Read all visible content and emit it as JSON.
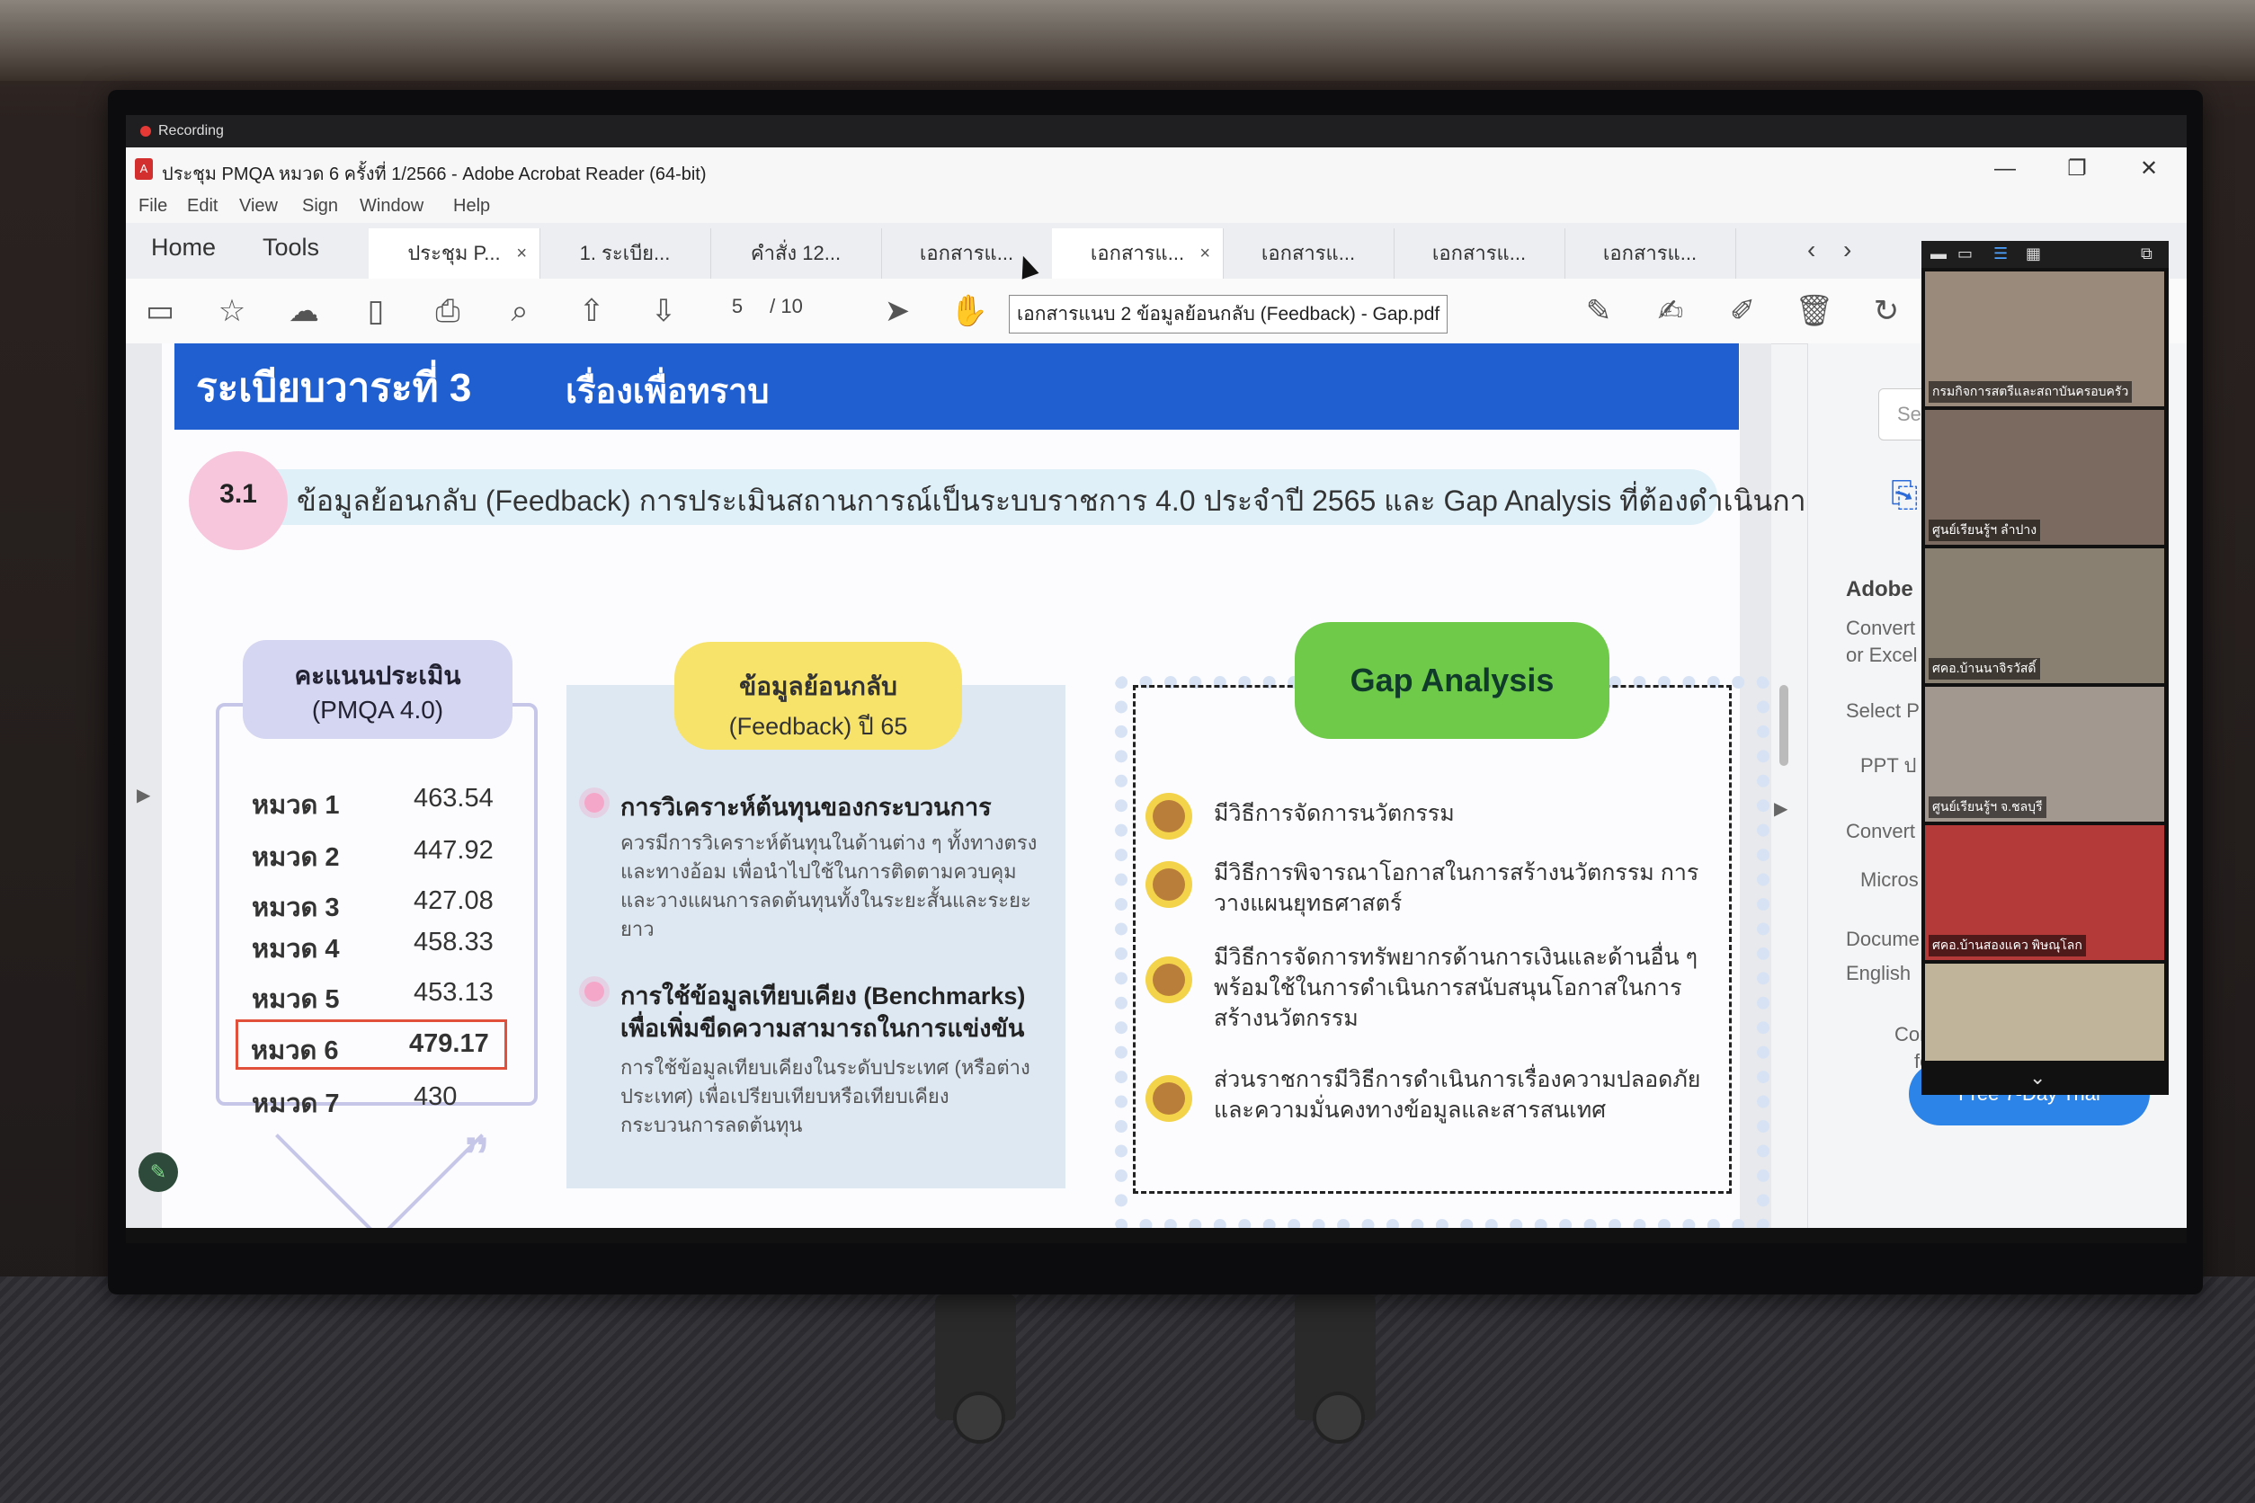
{
  "recording": {
    "label": "Recording"
  },
  "window": {
    "title": "ประชุม PMQA หมวด 6 ครั้งที่ 1/2566 - Adobe Acrobat Reader (64-bit)",
    "minimize": "—",
    "maximize": "❐",
    "close": "✕"
  },
  "menu": [
    "File",
    "Edit",
    "View",
    "Sign",
    "Window",
    "Help"
  ],
  "nav": {
    "home": "Home",
    "tools": "Tools"
  },
  "tabs": [
    "ประชุม P...",
    "1. ระเบีย...",
    "คำสั่ง 12...",
    "เอกสารแ...",
    "เอกสารแ...",
    "เอกสารแ...",
    "เอกสารแ...",
    "เอกสารแ..."
  ],
  "tab_close": "×",
  "tab_arrows": {
    "prev": "‹",
    "next": "›"
  },
  "toolbar": {
    "page_current": "5",
    "page_total": "/ 10"
  },
  "tooltip": "เอกสารแนบ 2 ข้อมูลย้อนกลับ (Feedback) - Gap.pdf",
  "doc": {
    "header_main": "ระเบียบวาระที่ 3",
    "header_sub": "เรื่องเพื่อทราบ",
    "section_no": "3.1",
    "section_text": "ข้อมูลย้อนกลับ (Feedback) การประเมินสถานการณ์เป็นระบบราชการ 4.0 ประจำปี 2565 และ Gap Analysis ที่ต้องดำเนินการฯ",
    "score": {
      "title1": "คะแนนประเมิน",
      "title2": "(PMQA 4.0)",
      "rows": [
        {
          "cat": "หมวด 1",
          "val": "463.54"
        },
        {
          "cat": "หมวด 2",
          "val": "447.92"
        },
        {
          "cat": "หมวด 3",
          "val": "427.08"
        },
        {
          "cat": "หมวด 4",
          "val": "458.33"
        },
        {
          "cat": "หมวด 5",
          "val": "453.13"
        },
        {
          "cat": "หมวด 6",
          "val": "479.17"
        },
        {
          "cat": "หมวด 7",
          "val": "430"
        }
      ]
    },
    "feedback": {
      "title1": "ข้อมูลย้อนกลับ",
      "title2": "(Feedback) ปี 65",
      "item1_head": "การวิเคราะห์ต้นทุนของกระบวนการ",
      "item1_body": "ควรมีการวิเคราะห์ต้นทุนในด้านต่าง ๆ ทั้งทางตรงและทางอ้อม เพื่อนำไปใช้ในการติดตามควบคุมและวางแผนการลดต้นทุนทั้งในระยะสั้นและระยะยาว",
      "item2_head1": "การใช้ข้อมูลเทียบเคียง (Benchmarks)",
      "item2_head2": "เพื่อเพิ่มขีดความสามารถในการแข่งขัน",
      "item2_body": "การใช้ข้อมูลเทียบเคียงในระดับประเทศ (หรือต่างประเทศ) เพื่อเปรียบเทียบหรือเทียบเคียงกระบวนการลดต้นทุน"
    },
    "gap": {
      "title": "Gap Analysis",
      "items": [
        "มีวิธีการจัดการนวัตกรรม",
        "มีวิธีการพิจารณาโอกาสในการสร้างนวัตกรรม การวางแผนยุทธศาสตร์",
        "มีวิธีการจัดการทรัพยากรด้านการเงินและด้านอื่น ๆ พร้อมใช้ในการดำเนินการสนับสนุนโอกาสในการสร้างนวัตกรรม",
        "ส่วนราชการมีวิธีการดำเนินการเรื่องความปลอดภัยและความมั่นคงทางข้อมูลและสารสนเทศ"
      ]
    }
  },
  "right_panel": {
    "search": "Searc",
    "adobe": "Adobe",
    "convert1": "Convert",
    "or_excel": "or Excel",
    "select": "Select P",
    "ppt": "PPT ป",
    "convert2": "Convert",
    "micro": "Micros",
    "docume": "Docume",
    "english": "English",
    "conv3": "Conv",
    "conv3b": "fo",
    "trial": "Free 7-Day Trial"
  },
  "zoom_tiles": [
    {
      "label": "กรมกิจการสตรีและสถาบันครอบครัว",
      "color": "#9a8a7c"
    },
    {
      "label": "ศูนย์เรียนรู้ฯ ลำปาง",
      "color": "#7a6a60"
    },
    {
      "label": "ศคอ.บ้านนาจิรวัสดิ์",
      "color": "#8a8072"
    },
    {
      "label": "ศูนย์เรียนรู้ฯ จ.ชลบุรี",
      "color": "#a39890"
    },
    {
      "label": "ศคอ.บ้านสองแคว พิษณุโลก",
      "color": "#b43a3a"
    },
    {
      "label": "",
      "color": "#c0b49a"
    }
  ],
  "colors": {
    "header_blue": "#1f5fd0",
    "gap_green": "#6fca4a",
    "feedback_yellow": "#f7e36a",
    "highlight_red": "#e0503a",
    "trial_blue": "#2d84e8"
  }
}
